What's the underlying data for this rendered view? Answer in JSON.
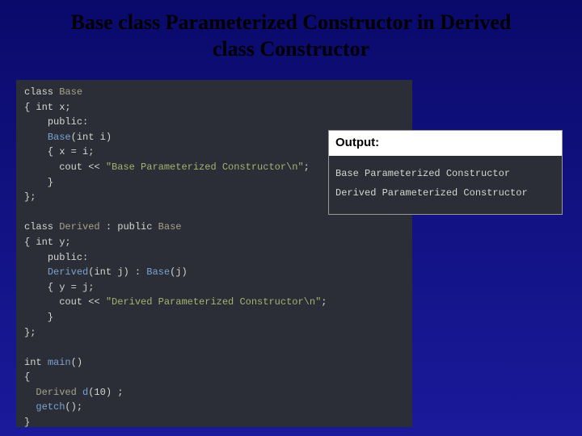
{
  "title": "Base class Parameterized Constructor in Derived class Constructor",
  "code": {
    "lines": [
      {
        "segments": [
          {
            "cls": "kw-type",
            "t": "class "
          },
          {
            "cls": "kw-name",
            "t": "Base"
          }
        ]
      },
      {
        "segments": [
          {
            "t": "{ "
          },
          {
            "cls": "kw-type",
            "t": "int "
          },
          {
            "t": "x;"
          }
        ]
      },
      {
        "segments": [
          {
            "t": "    "
          },
          {
            "cls": "kw-type",
            "t": "public"
          },
          {
            "t": ":"
          }
        ]
      },
      {
        "segments": [
          {
            "t": "    "
          },
          {
            "cls": "kw-call",
            "t": "Base"
          },
          {
            "t": "("
          },
          {
            "cls": "kw-type",
            "t": "int "
          },
          {
            "t": "i)"
          }
        ]
      },
      {
        "segments": [
          {
            "t": "    { x = i;"
          }
        ]
      },
      {
        "segments": [
          {
            "t": "      cout << "
          },
          {
            "cls": "kw-str",
            "t": "\"Base Parameterized Constructor\\n\""
          },
          {
            "t": ";"
          }
        ]
      },
      {
        "segments": [
          {
            "t": "    }"
          }
        ]
      },
      {
        "segments": [
          {
            "t": "};"
          }
        ]
      },
      {
        "segments": [
          {
            "t": ""
          }
        ]
      },
      {
        "segments": [
          {
            "cls": "kw-type",
            "t": "class "
          },
          {
            "cls": "kw-name",
            "t": "Derived"
          },
          {
            "t": " : "
          },
          {
            "cls": "kw-type",
            "t": "public "
          },
          {
            "cls": "kw-name",
            "t": "Base"
          }
        ]
      },
      {
        "segments": [
          {
            "t": "{ "
          },
          {
            "cls": "kw-type",
            "t": "int "
          },
          {
            "t": "y;"
          }
        ]
      },
      {
        "segments": [
          {
            "t": "    "
          },
          {
            "cls": "kw-type",
            "t": "public"
          },
          {
            "t": ":"
          }
        ]
      },
      {
        "segments": [
          {
            "t": "    "
          },
          {
            "cls": "kw-call",
            "t": "Derived"
          },
          {
            "t": "("
          },
          {
            "cls": "kw-type",
            "t": "int "
          },
          {
            "t": "j) : "
          },
          {
            "cls": "kw-call",
            "t": "Base"
          },
          {
            "t": "(j)"
          }
        ]
      },
      {
        "segments": [
          {
            "t": "    { y = j;"
          }
        ]
      },
      {
        "segments": [
          {
            "t": "      cout << "
          },
          {
            "cls": "kw-str",
            "t": "\"Derived Parameterized Constructor\\n\""
          },
          {
            "t": ";"
          }
        ]
      },
      {
        "segments": [
          {
            "t": "    }"
          }
        ]
      },
      {
        "segments": [
          {
            "t": "};"
          }
        ]
      },
      {
        "segments": [
          {
            "t": ""
          }
        ]
      },
      {
        "segments": [
          {
            "cls": "kw-type",
            "t": "int "
          },
          {
            "cls": "kw-call",
            "t": "main"
          },
          {
            "t": "()"
          }
        ]
      },
      {
        "segments": [
          {
            "t": "{"
          }
        ]
      },
      {
        "segments": [
          {
            "t": "  "
          },
          {
            "cls": "kw-name",
            "t": "Derived "
          },
          {
            "cls": "kw-call",
            "t": "d"
          },
          {
            "t": "(10) ;"
          }
        ]
      },
      {
        "segments": [
          {
            "t": "  "
          },
          {
            "cls": "kw-call",
            "t": "getch"
          },
          {
            "t": "();"
          }
        ]
      },
      {
        "segments": [
          {
            "t": "}"
          }
        ]
      }
    ]
  },
  "output": {
    "header": "Output:",
    "lines": [
      "Base Parameterized Constructor",
      "Derived Parameterized Constructor"
    ]
  }
}
